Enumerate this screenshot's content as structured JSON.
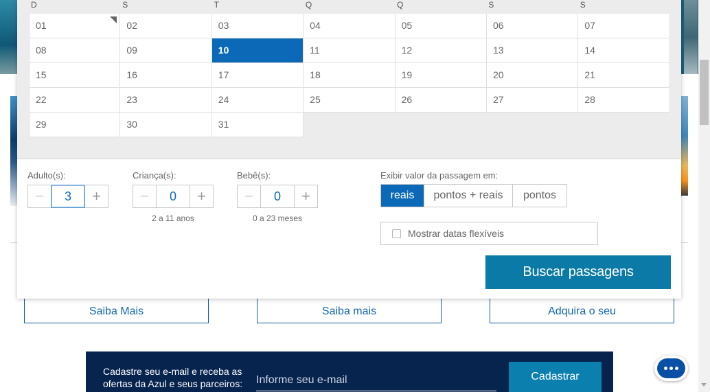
{
  "calendar": {
    "weekdays": [
      "D",
      "S",
      "T",
      "Q",
      "Q",
      "S",
      "S"
    ],
    "weeks": [
      [
        "01",
        "02",
        "03",
        "04",
        "05",
        "06",
        "07"
      ],
      [
        "08",
        "09",
        "10",
        "11",
        "12",
        "13",
        "14"
      ],
      [
        "15",
        "16",
        "17",
        "18",
        "19",
        "20",
        "21"
      ],
      [
        "22",
        "23",
        "24",
        "25",
        "26",
        "27",
        "28"
      ],
      [
        "29",
        "30",
        "31",
        "",
        "",
        "",
        ""
      ]
    ],
    "selected_day": "10"
  },
  "passengers": {
    "adults": {
      "label": "Adulto(s):",
      "value": "3",
      "hint": ""
    },
    "children": {
      "label": "Criança(s):",
      "value": "0",
      "hint": "2 a 11 anos"
    },
    "babies": {
      "label": "Bebê(s):",
      "value": "0",
      "hint": "0 a 23 meses"
    },
    "minus_symbol": "−",
    "plus_symbol": "+"
  },
  "price_display": {
    "label": "Exibir valor da passagem em:",
    "options": [
      "reais",
      "pontos + reais",
      "pontos"
    ],
    "selected": "reais"
  },
  "flexible_dates": {
    "label": "Mostrar datas flexíveis",
    "checked": false
  },
  "search_button": "Buscar passagens",
  "promo_links": [
    "Saiba Mais",
    "Saiba mais",
    "Adquira o seu"
  ],
  "newsletter": {
    "text": "Cadastre seu e-mail e receba as ofertas da Azul e seus parceiros:",
    "placeholder": "Informe seu e-mail",
    "button": "Cadastrar"
  },
  "colors": {
    "primary_blue": "#0b69b7",
    "search_teal": "#0b7aa6",
    "navy": "#07244f"
  },
  "icons": {
    "chat": "chat-bubble-icon",
    "flex_checkbox": "checkbox-icon"
  }
}
